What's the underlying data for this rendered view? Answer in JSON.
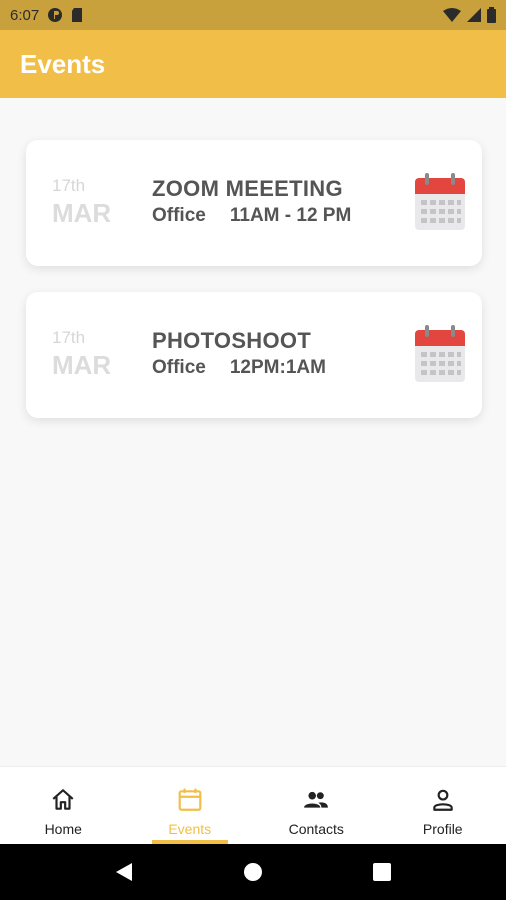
{
  "status_bar": {
    "time": "6:07"
  },
  "app_bar": {
    "title": "Events"
  },
  "events": [
    {
      "day": "17th",
      "month": "MAR",
      "title": "ZOOM MEEETING",
      "location": "Office",
      "time": "11AM - 12 PM"
    },
    {
      "day": "17th",
      "month": "MAR",
      "title": "PHOTOSHOOT",
      "location": "Office",
      "time": "12PM:1AM"
    }
  ],
  "bottom_nav": {
    "items": [
      {
        "label": "Home",
        "icon": "home-icon"
      },
      {
        "label": "Events",
        "icon": "calendar-icon",
        "active": true
      },
      {
        "label": "Contacts",
        "icon": "contacts-icon"
      },
      {
        "label": "Profile",
        "icon": "person-icon"
      }
    ]
  },
  "colors": {
    "accent": "#f1bf48",
    "status_bar": "#c9a13c",
    "calendar_red": "#e2463f"
  }
}
